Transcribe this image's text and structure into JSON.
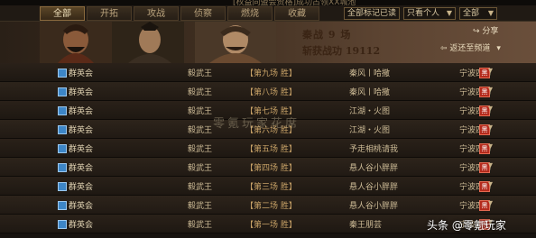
{
  "top_hint": "[权益同盟会资格]成功占领XX城池",
  "tabs": [
    {
      "label": "全部",
      "active": true
    },
    {
      "label": "开拓",
      "active": false
    },
    {
      "label": "攻战",
      "active": false
    },
    {
      "label": "侦察",
      "active": false
    },
    {
      "label": "燃烧",
      "active": false
    },
    {
      "label": "收藏",
      "active": false
    }
  ],
  "filters": {
    "mark_read": "全部标记已读",
    "scope": "只看个人",
    "category": "全部"
  },
  "banner": {
    "line1": "秦战 9 场",
    "line2": "斩获战功 19112",
    "share": "分享",
    "back": "返还至频道"
  },
  "rows": [
    {
      "name": "群英会",
      "king": "毅武王",
      "result": "【第九场 胜】",
      "opponent": "秦风丨哈撒",
      "side": "宁波四方",
      "badge": "黑"
    },
    {
      "name": "群英会",
      "king": "毅武王",
      "result": "【第八场 胜】",
      "opponent": "秦风丨哈撒",
      "side": "宁波四方",
      "badge": "黑"
    },
    {
      "name": "群英会",
      "king": "毅武王",
      "result": "【第七场 胜】",
      "opponent": "江湖・火图",
      "side": "宁波四方",
      "badge": "黑"
    },
    {
      "name": "群英会",
      "king": "毅武王",
      "result": "【第六场 胜】",
      "opponent": "江湖・火图",
      "side": "宁波四方",
      "badge": "黑"
    },
    {
      "name": "群英会",
      "king": "毅武王",
      "result": "【第五场 胜】",
      "opponent": "予走相桃请我",
      "side": "宁波四方",
      "badge": "黑"
    },
    {
      "name": "群英会",
      "king": "毅武王",
      "result": "【第四场 胜】",
      "opponent": "悬人谷小胖胖",
      "side": "宁波四方",
      "badge": "黑"
    },
    {
      "name": "群英会",
      "king": "毅武王",
      "result": "【第三场 胜】",
      "opponent": "悬人谷小胖胖",
      "side": "宁波四方",
      "badge": "黑"
    },
    {
      "name": "群英会",
      "king": "毅武王",
      "result": "【第二场 胜】",
      "opponent": "悬人谷小胖胖",
      "side": "宁波四方",
      "badge": "黑"
    },
    {
      "name": "群英会",
      "king": "毅武王",
      "result": "【第一场 胜】",
      "opponent": "秦王朋芸",
      "side": "宁波四方",
      "badge": "黑"
    }
  ],
  "watermark": "零氪玩家花席",
  "corner_label": "头条 @零氪玩家"
}
